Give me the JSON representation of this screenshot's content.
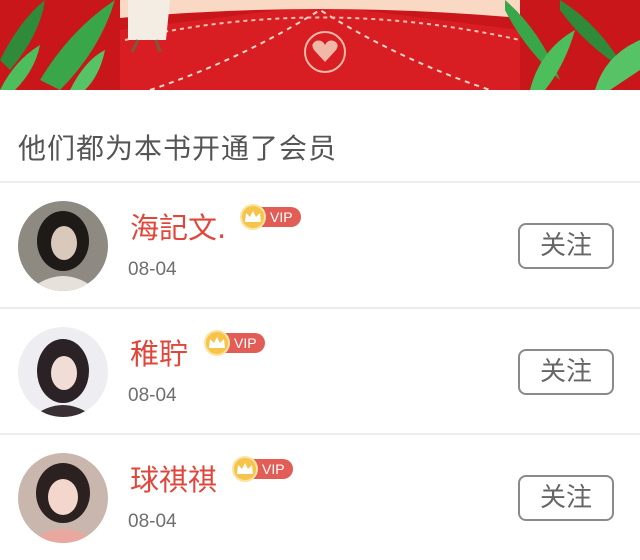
{
  "banner": {
    "accent": "#c9161b"
  },
  "section": {
    "title": "他们都为本书开通了会员"
  },
  "members": [
    {
      "name": "海記文.",
      "vip_label": "VIP",
      "date": "08-04",
      "follow_label": "关注"
    },
    {
      "name": "稚聍",
      "vip_label": "VIP",
      "date": "08-04",
      "follow_label": "关注"
    },
    {
      "name": "球祺祺",
      "vip_label": "VIP",
      "date": "08-04",
      "follow_label": "关注"
    }
  ],
  "colors": {
    "name": "#e0473b",
    "vip_pill": "#e25d55",
    "crown": "#f6c44a"
  }
}
